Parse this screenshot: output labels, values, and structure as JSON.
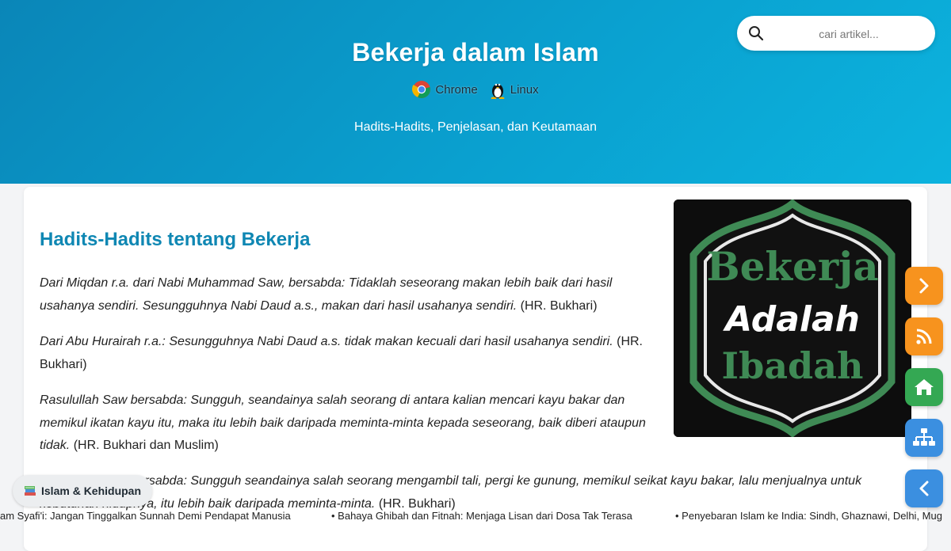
{
  "header": {
    "title": "Bekerja dalam Islam",
    "envs": [
      {
        "icon": "chrome-icon",
        "label": "Chrome"
      },
      {
        "icon": "linux-tux-icon",
        "label": "Linux"
      }
    ],
    "subtitle": "Hadits-Hadits, Penjelasan, dan Keutamaan"
  },
  "search": {
    "placeholder": "cari artikel...",
    "value": ""
  },
  "hero_image": {
    "line1": "Bekerja",
    "line2": "Adalah",
    "line3": "Ibadah"
  },
  "article": {
    "heading": "Hadits-Hadits tentang Bekerja",
    "paragraphs": [
      {
        "quote": "Dari Miqdan r.a. dari Nabi Muhammad Saw, bersabda: Tidaklah seseorang makan lebih baik dari hasil usahanya sendiri. Sesungguhnya Nabi Daud a.s., makan dari hasil usahanya sendiri.",
        "source": "(HR. Bukhari)"
      },
      {
        "quote": "Dari Abu Hurairah r.a.: Sesungguhnya Nabi Daud a.s. tidak makan kecuali dari hasil usahanya sendiri.",
        "source": "(HR. Bukhari)"
      },
      {
        "quote": "Rasulullah Saw bersabda: Sungguh, seandainya salah seorang di antara kalian mencari kayu bakar dan memikul ikatan kayu itu, maka itu lebih baik daripada meminta-minta kepada seseorang, baik diberi ataupun tidak.",
        "source": "(HR. Bukhari dan Muslim)"
      },
      {
        "quote": "Rasulullah Saw bersabda: Sungguh seandainya salah seorang mengambil tali, pergi ke gunung, memikul seikat kayu bakar, lalu menjualnya untuk kebutuhan hidupnya, itu lebih baik daripada meminta-minta.",
        "source": "(HR. Bukhari)"
      }
    ]
  },
  "category_badge": {
    "icon": "books-icon",
    "label": "Islam & Kehidupan"
  },
  "ticker": [
    "am Syafi'i: Jangan Tinggalkan Sunnah Demi Pendapat Manusia",
    "• Bahaya Ghibah dan Fitnah: Menjaga Lisan dari Dosa Tak Terasa",
    "• Penyebaran Islam ke India: Sindh, Ghaznawi, Delhi, Mug"
  ],
  "fab_buttons": [
    {
      "name": "next-button",
      "icon": "chevron-right-icon",
      "color": "#f7931e"
    },
    {
      "name": "rss-button",
      "icon": "rss-icon",
      "color": "#f7931e"
    },
    {
      "name": "home-button",
      "icon": "home-icon",
      "color": "#34a853"
    },
    {
      "name": "sitemap-button",
      "icon": "sitemap-icon",
      "color": "#3b8fe0"
    },
    {
      "name": "back-button",
      "icon": "chevron-left-icon",
      "color": "#3b8fe0"
    }
  ]
}
